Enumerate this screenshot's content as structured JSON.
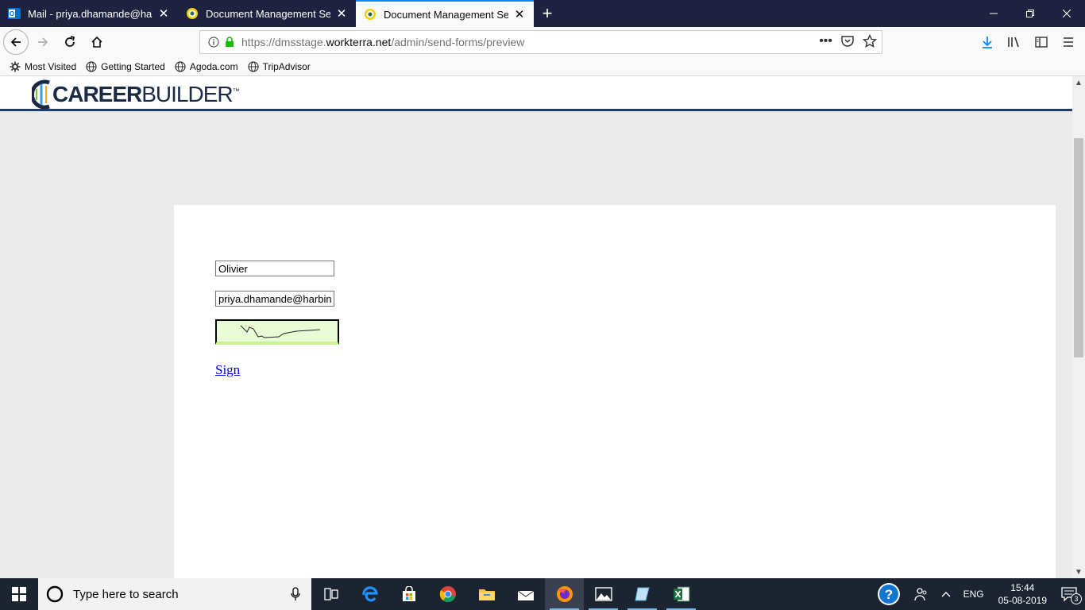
{
  "browser": {
    "tabs": [
      {
        "label": "Mail - priya.dhamande@harbin",
        "active": false
      },
      {
        "label": "Document Management Servic",
        "active": false
      },
      {
        "label": "Document Management Servic",
        "active": true
      }
    ],
    "url_prefix": "https://dmsstage.",
    "url_domain": "workterra.net",
    "url_path": "/admin/send-forms/preview",
    "bookmarks": [
      "Most Visited",
      "Getting Started",
      "Agoda.com",
      "TripAdvisor"
    ]
  },
  "page": {
    "logo_part1": "CAREER",
    "logo_part2": "BUILDER",
    "logo_tm": "™",
    "form": {
      "name_value": "Olivier",
      "email_value": "priya.dhamande@harbinger",
      "sign_link": "Sign"
    }
  },
  "taskbar": {
    "search_placeholder": "Type here to search",
    "lang": "ENG",
    "time": "15:44",
    "date": "05-08-2019",
    "notification_count": "3"
  },
  "colors": {
    "tabstrip": "#202340",
    "accent": "#0a84ff",
    "header_border": "#1d3f6e",
    "signature_bg": "#e9fcd6",
    "taskbar": "#1c2331"
  }
}
